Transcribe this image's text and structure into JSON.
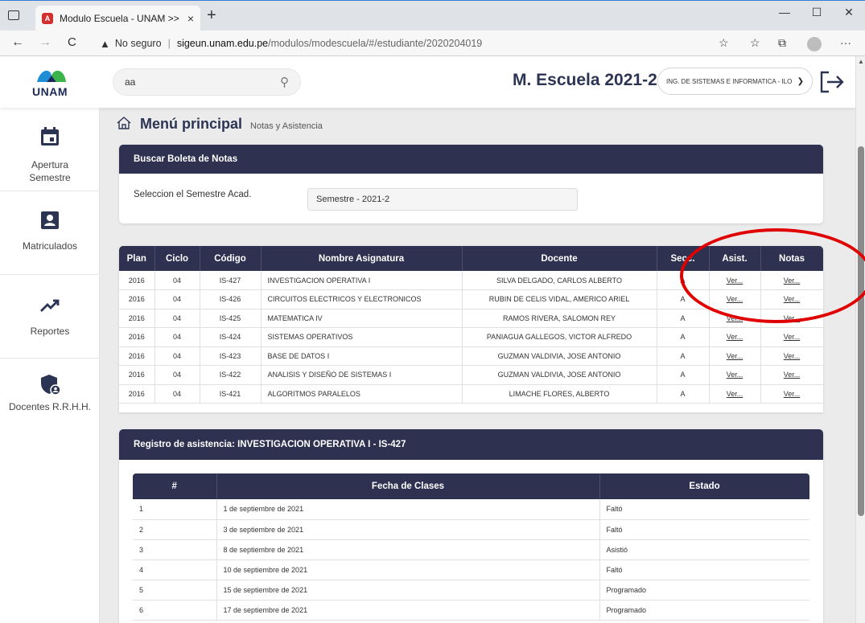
{
  "browser": {
    "tab_title": "Modulo Escuela - UNAM >>",
    "tab_favicon": "A",
    "tab_close": "×",
    "new_tab": "+",
    "security": "No seguro",
    "url_host": "sigeun.unam.edu.pe",
    "url_path": "/modulos/modescuela/#/estudiante/2020204019",
    "controls": {
      "minimize": "—",
      "maximize": "☐",
      "close": "✕"
    },
    "nav": {
      "back": "←",
      "forward": "→",
      "reload": "C"
    },
    "extra_icons": {
      "read_aloud": "☆",
      "favorites": "☆",
      "collections": "⧉",
      "menu": "···"
    }
  },
  "header": {
    "logo_text": "UNAM",
    "search_value": "aa",
    "title": "M. Escuela 2021-2",
    "school_select": "ING. DE SISTEMAS E INFORMATICA - ILO"
  },
  "sidebar": {
    "items": [
      {
        "label": "Apertura\nSemestre",
        "icon": "calendar-icon"
      },
      {
        "label": "Matriculados",
        "icon": "person-badge-icon"
      },
      {
        "label": "Reportes",
        "icon": "trending-up-icon"
      },
      {
        "label": "Docentes R.R.H.H.",
        "icon": "shield-user-icon"
      }
    ]
  },
  "breadcrumb": {
    "title": "Menú principal",
    "subtitle": "Notas y Asistencia"
  },
  "boleta": {
    "header": "Buscar Boleta de Notas",
    "label": "Seleccion el Semestre Acad.",
    "value": "Semestre - 2021-2"
  },
  "courses": {
    "columns": [
      "Plan",
      "Ciclo",
      "Código",
      "Nombre Asignatura",
      "Docente",
      "Secc.",
      "Asist.",
      "Notas"
    ],
    "link_text": "Ver...",
    "rows": [
      {
        "plan": "2016",
        "ciclo": "04",
        "codigo": "IS-427",
        "nombre": "INVESTIGACION OPERATIVA I",
        "docente": "SILVA DELGADO, CARLOS ALBERTO",
        "secc": "A"
      },
      {
        "plan": "2016",
        "ciclo": "04",
        "codigo": "IS-426",
        "nombre": "CIRCUITOS ELECTRICOS Y ELECTRONICOS",
        "docente": "RUBIN DE CELIS VIDAL, AMERICO ARIEL",
        "secc": "A"
      },
      {
        "plan": "2016",
        "ciclo": "04",
        "codigo": "IS-425",
        "nombre": "MATEMATICA IV",
        "docente": "RAMOS RIVERA, SALOMON REY",
        "secc": "A"
      },
      {
        "plan": "2016",
        "ciclo": "04",
        "codigo": "IS-424",
        "nombre": "SISTEMAS OPERATIVOS",
        "docente": "PANIAGUA GALLEGOS, VICTOR ALFREDO",
        "secc": "A"
      },
      {
        "plan": "2016",
        "ciclo": "04",
        "codigo": "IS-423",
        "nombre": "BASE DE DATOS I",
        "docente": "GUZMAN VALDIVIA, JOSE ANTONIO",
        "secc": "A"
      },
      {
        "plan": "2016",
        "ciclo": "04",
        "codigo": "IS-422",
        "nombre": "ANALISIS Y DISEÑO DE SISTEMAS I",
        "docente": "GUZMAN VALDIVIA, JOSE ANTONIO",
        "secc": "A"
      },
      {
        "plan": "2016",
        "ciclo": "04",
        "codigo": "IS-421",
        "nombre": "ALGORITMOS PARALELOS",
        "docente": "LIMACHE FLORES, ALBERTO",
        "secc": "A"
      }
    ]
  },
  "attendance": {
    "header": "Registro de asistencia: INVESTIGACION OPERATIVA I - IS-427",
    "columns": [
      "#",
      "Fecha de Clases",
      "Estado"
    ],
    "rows": [
      {
        "n": "1",
        "fecha": "1 de septiembre de 2021",
        "estado": "Faltó"
      },
      {
        "n": "2",
        "fecha": "3 de septiembre de 2021",
        "estado": "Faltó"
      },
      {
        "n": "3",
        "fecha": "8 de septiembre de 2021",
        "estado": "Asistió"
      },
      {
        "n": "4",
        "fecha": "10 de septiembre de 2021",
        "estado": "Faltó"
      },
      {
        "n": "5",
        "fecha": "15 de septiembre de 2021",
        "estado": "Programado"
      },
      {
        "n": "6",
        "fecha": "17 de septiembre de 2021",
        "estado": "Programado"
      }
    ]
  },
  "colors": {
    "header_dark": "#2e3150",
    "title": "#2c3454",
    "annotation": "#e00000"
  }
}
